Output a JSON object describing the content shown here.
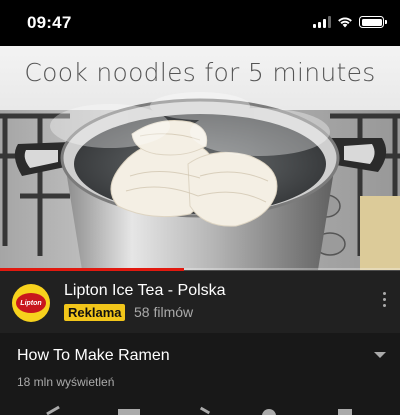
{
  "status_bar": {
    "time": "09:47",
    "icons": [
      "cellular-signal-icon",
      "wifi-icon",
      "battery-icon"
    ]
  },
  "video": {
    "caption": "Cook noodles for 5 minutes",
    "progress": 0.46
  },
  "channel": {
    "name": "Lipton Ice Tea - Polska",
    "ad_label": "Reklama",
    "video_count": "58 filmów",
    "avatar_text": "Lipton"
  },
  "details": {
    "title": "How To Make Ramen",
    "views": "18 mln wyświetleń"
  },
  "colors": {
    "progress": "#e1190f",
    "ad_badge": "#f2c61a",
    "avatar_bg": "#f7d21d"
  }
}
